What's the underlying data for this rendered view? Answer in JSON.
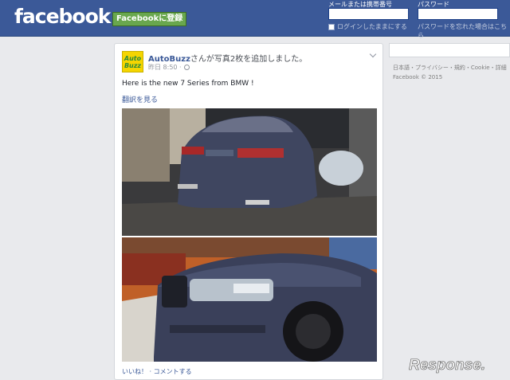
{
  "header": {
    "logo": "facebook",
    "signup_label": "Facebookに登録",
    "email_label": "メールまたは携帯番号",
    "password_label": "パスワード",
    "keep_logged_in": "ログインしたままにする",
    "forgot_password": "パスワードを忘れた場合はこちら"
  },
  "post": {
    "avatar_text": "Auto\nBuzz",
    "author": "AutoBuzz",
    "action_text": "さんが写真2枚を追加しました。",
    "time": "昨日 8:50 ·",
    "text": "Here is the new 7 Series from BMW !",
    "translate": "翻訳を見る",
    "actions": "いいね！ · コメントする"
  },
  "sidebar": {
    "links": "日本語・プライバシー・規約・Cookie・詳細",
    "copyright": "Facebook © 2015"
  },
  "watermark": {
    "text": "Response."
  },
  "colors": {
    "header_blue": "#3b5998",
    "signup_green": "#69a74e",
    "link_blue": "#3b5998",
    "page_bg": "#e9eaed"
  }
}
